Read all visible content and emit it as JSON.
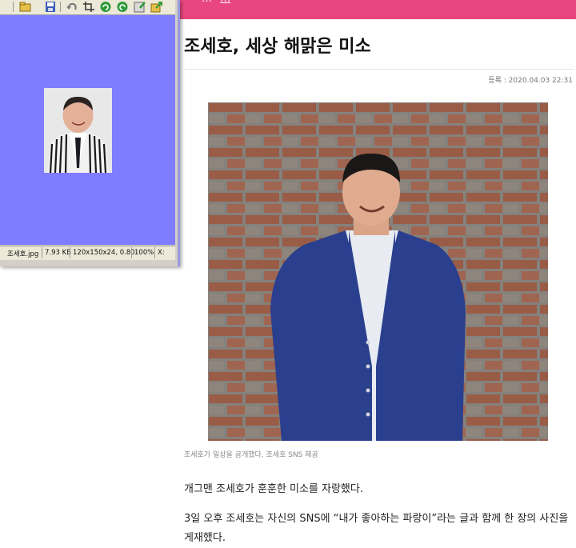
{
  "viewer": {
    "status": {
      "filename": "조세호.jpg",
      "filesize": "7.93 KB",
      "dimensions": "120x150x24, 0.80",
      "zoom": "100%",
      "extra": "X:"
    },
    "toolbar_icons": [
      "open-folder-icon",
      "save-icon",
      "undo-icon",
      "crop-icon",
      "rotate-left-icon",
      "rotate-right-icon",
      "zoom-icon",
      "export-icon"
    ],
    "canvas_color": "#7f7cff"
  },
  "article": {
    "banner_text": "…",
    "banner_link": "…",
    "banner_color": "#e8467f",
    "title": "조세호, 세상 해맑은 미소",
    "dateline": "등록 : 2020.04.03  22:31",
    "caption": "조세호가 일상을 공개했다. 조세호 SNS 제공",
    "paragraph1": "개그맨 조세호가 훈훈한 미소를 자랑했다.",
    "paragraph2": "3일 오후 조세호는 자신의 SNS에 “내가 좋아하는 파랑이”라는 글과 함께 한 장의 사진을 게재했다."
  }
}
